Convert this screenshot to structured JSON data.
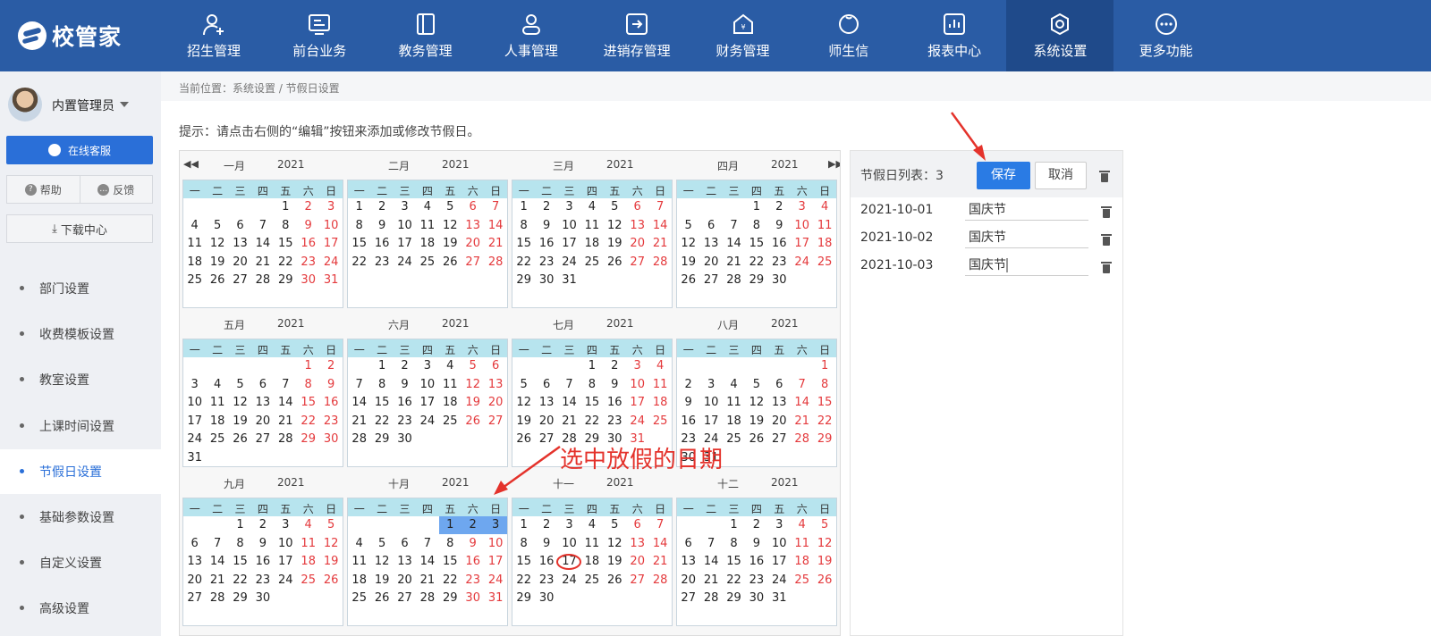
{
  "app": {
    "logo_text": "校管家"
  },
  "nav": [
    {
      "label": "招生管理",
      "icon": "user-plus-icon",
      "active": false
    },
    {
      "label": "前台业务",
      "icon": "monitor-icon",
      "active": false
    },
    {
      "label": "教务管理",
      "icon": "book-icon",
      "active": false
    },
    {
      "label": "人事管理",
      "icon": "person-icon",
      "active": false
    },
    {
      "label": "进销存管理",
      "icon": "inventory-icon",
      "active": false
    },
    {
      "label": "财务管理",
      "icon": "finance-icon",
      "active": false
    },
    {
      "label": "师生信",
      "icon": "chat-icon",
      "active": false
    },
    {
      "label": "报表中心",
      "icon": "report-icon",
      "active": false
    },
    {
      "label": "系统设置",
      "icon": "settings-icon",
      "active": true
    },
    {
      "label": "更多功能",
      "icon": "more-icon",
      "active": false
    }
  ],
  "sidebar": {
    "user_name": "内置管理员",
    "online_service": "在线客服",
    "help": "帮助",
    "feedback": "反馈",
    "download": "下载中心",
    "items": [
      {
        "label": "部门设置",
        "active": false
      },
      {
        "label": "收费模板设置",
        "active": false
      },
      {
        "label": "教室设置",
        "active": false
      },
      {
        "label": "上课时间设置",
        "active": false
      },
      {
        "label": "节假日设置",
        "active": true
      },
      {
        "label": "基础参数设置",
        "active": false
      },
      {
        "label": "自定义设置",
        "active": false
      },
      {
        "label": "高级设置",
        "active": false
      }
    ]
  },
  "breadcrumb": "当前位置：系统设置 / 节假日设置",
  "hint": "提示：请点击右侧的“编辑”按钮来添加或修改节假日。",
  "calendar": {
    "year": "2021",
    "weekdays": [
      "一",
      "二",
      "三",
      "四",
      "五",
      "六",
      "日"
    ],
    "months": [
      "一月",
      "二月",
      "三月",
      "四月",
      "五月",
      "六月",
      "七月",
      "八月",
      "九月",
      "十月",
      "十一",
      "十二"
    ],
    "selected_dates": [
      "2021-10-01",
      "2021-10-02",
      "2021-10-03"
    ]
  },
  "holiday_list": {
    "title": "节假日列表：3",
    "save": "保存",
    "cancel": "取消",
    "rows": [
      {
        "date": "2021-10-01",
        "name": "国庆节"
      },
      {
        "date": "2021-10-02",
        "name": "国庆节"
      },
      {
        "date": "2021-10-03",
        "name": "国庆节"
      }
    ]
  },
  "annotation": {
    "text": "选中放假的日期",
    "color": "#e4322b"
  },
  "colors": {
    "topbar": "#2a5ca5",
    "accent": "#2a7be4",
    "weekend": "#e4393c",
    "selected": "#6ea7ef",
    "weekday_header": "#b7e4ee"
  }
}
